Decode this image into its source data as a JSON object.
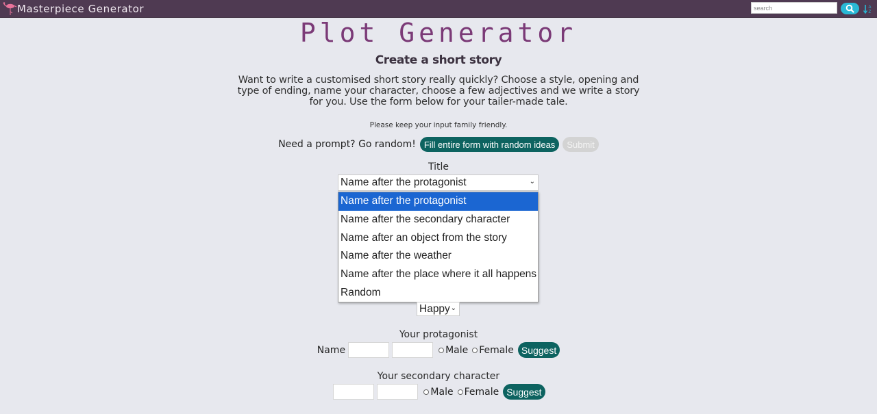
{
  "navbar": {
    "brand": "Masterpiece Generator",
    "search_placeholder": "search",
    "search_value": "",
    "search_icon": "magnifier-icon",
    "sort_icon": "sort-alpha-icon",
    "colors": {
      "bar": "#4f3a52",
      "accent": "#29b9d6",
      "logo": "#e8739a"
    }
  },
  "header": {
    "title": "Plot Generator",
    "subtitle": "Create a short story",
    "intro": "Want to write a customised short story really quickly? Choose a style, opening and type of ending, name your character, choose a few adjectives and we write a story for you. Use the form below for your tailer-made tale.",
    "notice": "Please keep your input family friendly."
  },
  "random": {
    "label": "Need a prompt? Go random!",
    "fill_button": "Fill entire form with random ideas",
    "submit_button": "Submit"
  },
  "title_field": {
    "label": "Title",
    "selected": "Name after the protagonist",
    "options": [
      "Name after the protagonist",
      "Name after the secondary character",
      "Name after an object from the story",
      "Name after the weather",
      "Name after the place where it all happens",
      "Random"
    ],
    "highlighted_index": 0
  },
  "mood_field": {
    "selected": "Happy"
  },
  "protagonist": {
    "label": "Your protagonist",
    "name_label": "Name",
    "first_value": "",
    "last_value": "",
    "male": "Male",
    "female": "Female",
    "suggest": "Suggest"
  },
  "secondary": {
    "label": "Your secondary character",
    "first_value": "",
    "last_value": "",
    "male": "Male",
    "female": "Female",
    "suggest": "Suggest"
  },
  "colors": {
    "title": "#7b3a77",
    "button": "#0d6360",
    "highlight": "#1b66d2",
    "background": "#e7e8ee"
  }
}
